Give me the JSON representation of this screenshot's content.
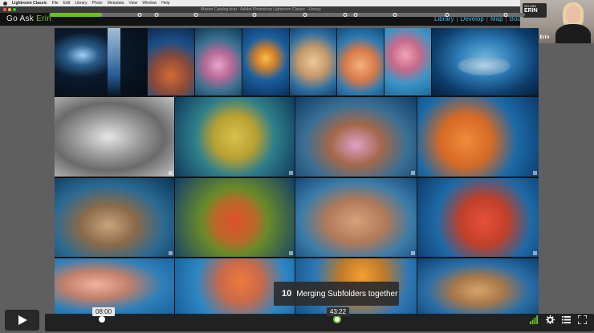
{
  "menubar": {
    "items": [
      "Lightroom Classic",
      "File",
      "Edit",
      "Library",
      "Photo",
      "Metadata",
      "View",
      "Window",
      "Help"
    ]
  },
  "window": {
    "title": "Master Catalog.lrcat - Adobe Photoshop Lightroom Classic - Library"
  },
  "brand": {
    "prefix": "Go Ask ",
    "accent": "Erin",
    "accent_color": "#7ac043"
  },
  "modules": [
    "Library",
    "Develop",
    "Map",
    "Book"
  ],
  "module_color": "#3fb7e6",
  "webcam": {
    "logo_line1": "GO ASK",
    "logo_line2": "ERIN",
    "caption": "Go Ask Erin"
  },
  "chapter": {
    "number": "10",
    "title": "Merging Subfolders together"
  },
  "player": {
    "current_time": "08:00",
    "hover_time": "43:22",
    "progress_fraction": 0.11,
    "accent_color": "#6bbf2a",
    "icons": [
      "signal-icon",
      "gear-icon",
      "playlist-icon",
      "fullscreen-icon"
    ]
  }
}
